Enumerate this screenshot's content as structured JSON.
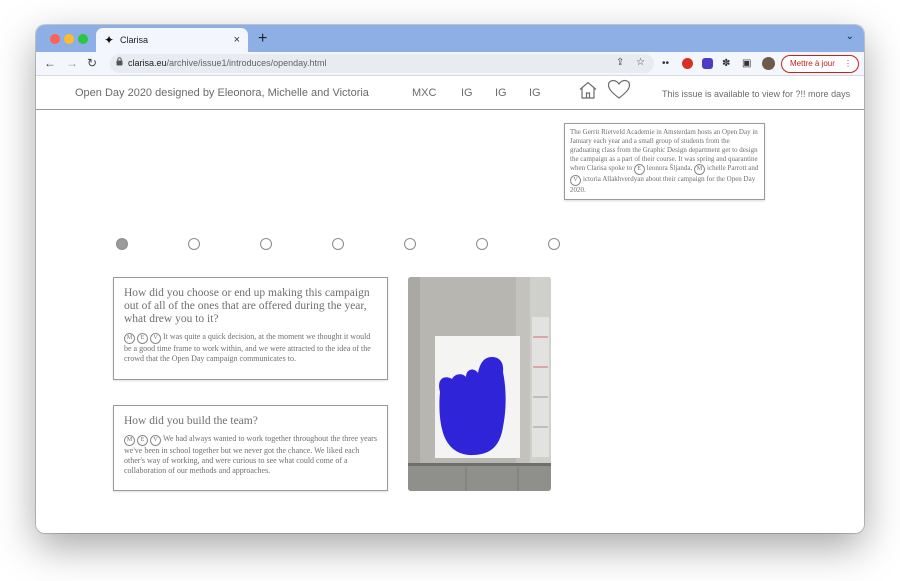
{
  "browser": {
    "tab_title": "Clarisa",
    "tab_favicon": "✦",
    "tab_close": "×",
    "new_tab": "+",
    "tab_menu": "⌄",
    "url_host": "clarisa.eu",
    "url_path": "/archive/issue1/introduces/openday.html",
    "update_button_label": "Mettre à jour",
    "update_button_menu": "⋮"
  },
  "icons": {
    "back": "←",
    "forward": "→",
    "reload": "↻",
    "lock": "🔒",
    "share": "⇪",
    "star": "☆",
    "extensions": "✽",
    "sidebar": "▣"
  },
  "header": {
    "title": "Open Day 2020 designed by Eleonora, Michelle and Victoria",
    "links": [
      "MXC",
      "IG",
      "IG",
      "IG"
    ],
    "availability": "This issue is available to view for ?!! more days"
  },
  "intro": {
    "text_1": "The Gerrit Rietveld Academie in Amsterdam hosts an Open Day in January each year and a small group of students from the graduating class from the Graphic Design department get to design the campaign as a part of their course. It was spring and quarantine when Clarisa spoke to ",
    "initial_e": "E",
    "text_2": "leonora Šljanda, ",
    "initial_m": "M",
    "text_3": "ichelle Parrott and ",
    "initial_v": "V",
    "text_4": "ictoria Allakhverdyan about their campaign for the Open Day 2020."
  },
  "pagination": {
    "total": 7,
    "active": 0
  },
  "qa": [
    {
      "question": "How did you choose or end up making this campaign out of all of the ones that are offered during the year, what drew you to it?",
      "badges": [
        "M",
        "E",
        "V"
      ],
      "answer": "It was quite a quick decision, at the moment we thought it would be a good time frame to work within, and we were attracted to the idea of the crowd that the Open Day campaign communicates to."
    },
    {
      "question": "How did you build the team?",
      "badges": [
        "M",
        "E",
        "V"
      ],
      "answer": "We had always wanted to work together throughout the three years we've been in school together but we never got the chance. We liked each other's way of working, and were curious to see what could come of a collaboration of our methods and approaches."
    }
  ],
  "colors": {
    "chrome_tab_strip": "#8eaee6",
    "text_gray": "#6f6f6f",
    "poster_blue": "#2f24d8",
    "update_red": "#c5221f"
  }
}
